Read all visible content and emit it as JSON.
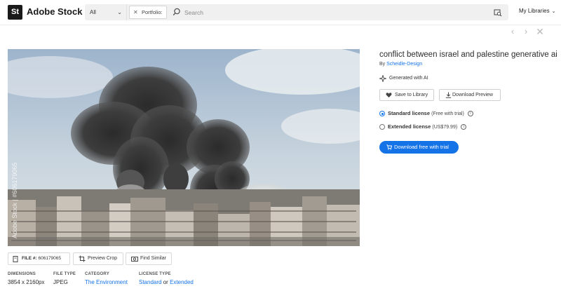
{
  "header": {
    "logo_text": "St",
    "brand": "Adobe Stock",
    "filter_value": "All",
    "chip_label": "Portfolio:",
    "search_placeholder": "Search",
    "libraries_label": "My Libraries"
  },
  "asset": {
    "title": "conflict between israel and palestine generative ai",
    "by_prefix": "By",
    "author": "Scheidle-Design",
    "generated_label": "Generated with AI",
    "save_label": "Save to Library",
    "download_preview_label": "Download Preview",
    "watermark_text": "Adobe Stock | #606179065"
  },
  "licenses": [
    {
      "name": "Standard license",
      "detail": "(Free with trial)",
      "selected": true
    },
    {
      "name": "Extended license",
      "detail": "(US$79.99)",
      "selected": false
    }
  ],
  "cta_label": "Download free with trial",
  "file_bar": {
    "file_label": "FILE #:",
    "file_number": "606179065",
    "crop_label": "Preview Crop",
    "similar_label": "Find Similar"
  },
  "meta": {
    "dimensions_label": "DIMENSIONS",
    "dimensions_value": "3854 x 2160px",
    "filetype_label": "FILE TYPE",
    "filetype_value": "JPEG",
    "category_label": "CATEGORY",
    "category_value": "The Environment",
    "license_type_label": "LICENSE TYPE",
    "license_standard": "Standard",
    "license_or": "or",
    "license_extended": "Extended"
  },
  "colors": {
    "accent": "#1473e6",
    "logo_bg": "#1a1a1a"
  }
}
